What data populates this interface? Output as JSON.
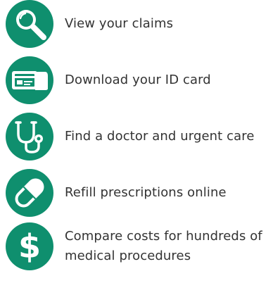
{
  "colors": {
    "accent": "#0f8f6e",
    "text": "#333333",
    "background": "#ffffff"
  },
  "features": [
    {
      "label": "View your claims",
      "icon": "magnifier-icon"
    },
    {
      "label": "Download your ID card",
      "icon": "id-card-icon"
    },
    {
      "label": "Find a doctor and urgent care",
      "icon": "stethoscope-icon"
    },
    {
      "label": "Refill prescriptions online",
      "icon": "pill-icon"
    },
    {
      "label": "Compare costs for hundreds of medical procedures",
      "icon": "dollar-icon"
    }
  ]
}
